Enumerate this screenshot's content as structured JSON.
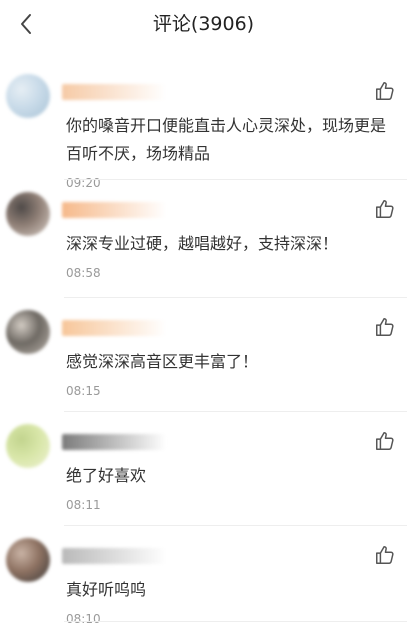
{
  "header": {
    "title": "评论(3906)",
    "back_icon": "chevron-left-icon"
  },
  "comments": [
    {
      "text": "你的嗓音开口便能直击人心灵深处，现场更是百听不厌，场场精品",
      "time": "09:20",
      "avatar_colors": [
        "#c9dbe9",
        "#a9c3d6",
        "#e6eef4"
      ],
      "nickname_color": "#f6caa6"
    },
    {
      "text": "深深专业过硬，越唱越好，支持深深！",
      "time": "08:58",
      "avatar_colors": [
        "#8f7f76",
        "#d9cfc7",
        "#4f4a48"
      ],
      "nickname_color": "#f6b98a"
    },
    {
      "text": "感觉深深高音区更丰富了！",
      "time": "08:15",
      "avatar_colors": [
        "#6f6a64",
        "#b9b2aa",
        "#d2cbc3"
      ],
      "nickname_color": "#f7c69a"
    },
    {
      "text": "绝了好喜欢",
      "time": "08:11",
      "avatar_colors": [
        "#d8e6a8",
        "#eef2d2",
        "#c2d48e"
      ],
      "nickname_color": "#7b7b7b"
    },
    {
      "text": "真好听呜呜",
      "time": "08:10",
      "avatar_colors": [
        "#8e7262",
        "#3b3a3a",
        "#c9b3a5"
      ],
      "nickname_color": "#b9b9b9"
    }
  ]
}
